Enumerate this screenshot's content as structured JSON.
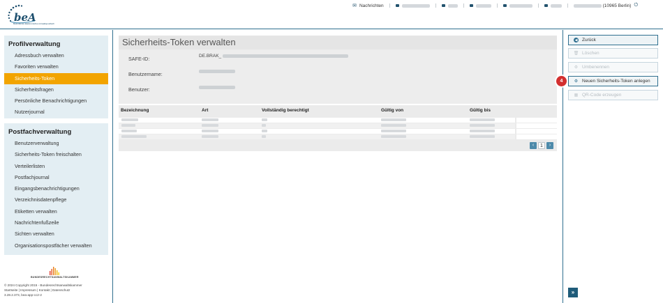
{
  "app": {
    "logo_text": "beA",
    "logo_subtitle": "Besonderes Elektronisches Anwaltspostfach"
  },
  "topnav": {
    "messages_label": "Nachrichten",
    "user_label": "(10965 Berlin)",
    "power_icon": "power-icon"
  },
  "sidebar": {
    "profile_heading": "Profilverwaltung",
    "profile_items": [
      {
        "label": "Adressbuch verwalten"
      },
      {
        "label": "Favoriten verwalten"
      },
      {
        "label": "Sicherheits-Token"
      },
      {
        "label": "Sicherheitsfragen"
      },
      {
        "label": "Persönliche Benachrichtigungen"
      },
      {
        "label": "Nutzerjournal"
      }
    ],
    "mailbox_heading": "Postfachverwaltung",
    "mailbox_items": [
      {
        "label": "Benutzerverwaltung"
      },
      {
        "label": "Sicherheits-Token freischalten"
      },
      {
        "label": "Verteilerlisten"
      },
      {
        "label": "Postfachjournal"
      },
      {
        "label": "Eingangsbenachrichtigungen"
      },
      {
        "label": "Verzeichnisdatenpflege"
      },
      {
        "label": "Etiketten verwalten"
      },
      {
        "label": "Nachrichtenfußzeile"
      },
      {
        "label": "Sichten verwalten"
      },
      {
        "label": "Organisationspostfächer verwalten"
      }
    ],
    "brak_name": "BUNDESRECHTSANWALTSKAMMER",
    "footer_copyright": "© 2024 Copyright 2015 - Bundesrechtsanwaltskammer",
    "footer_links": "Startseite | Impressum | Kontakt | Datenschutz",
    "footer_version": "3.28.2.373, bea-app-cc2-2"
  },
  "main": {
    "title": "Sicherheits-Token verwalten",
    "safe_id_label": "SAFE-ID:",
    "safe_id_value": "DE.BRAK_",
    "username_label": "Benutzername:",
    "user_label": "Benutzer:",
    "table": {
      "headers": [
        "Bezeichnung",
        "Art",
        "Vollständig berechtigt",
        "Gültig von",
        "Gültig bis"
      ],
      "row_count": 4
    },
    "pager": {
      "prev": "‹",
      "page": "1",
      "next": "›"
    }
  },
  "actions": {
    "back": "Zurück",
    "delete": "Löschen",
    "rename": "Umbenennen",
    "new_token": "Neuen Sicherheits-Token anlegen",
    "qr_code": "QR-Code erzeugen",
    "step_badge": "4",
    "expand": "»"
  }
}
